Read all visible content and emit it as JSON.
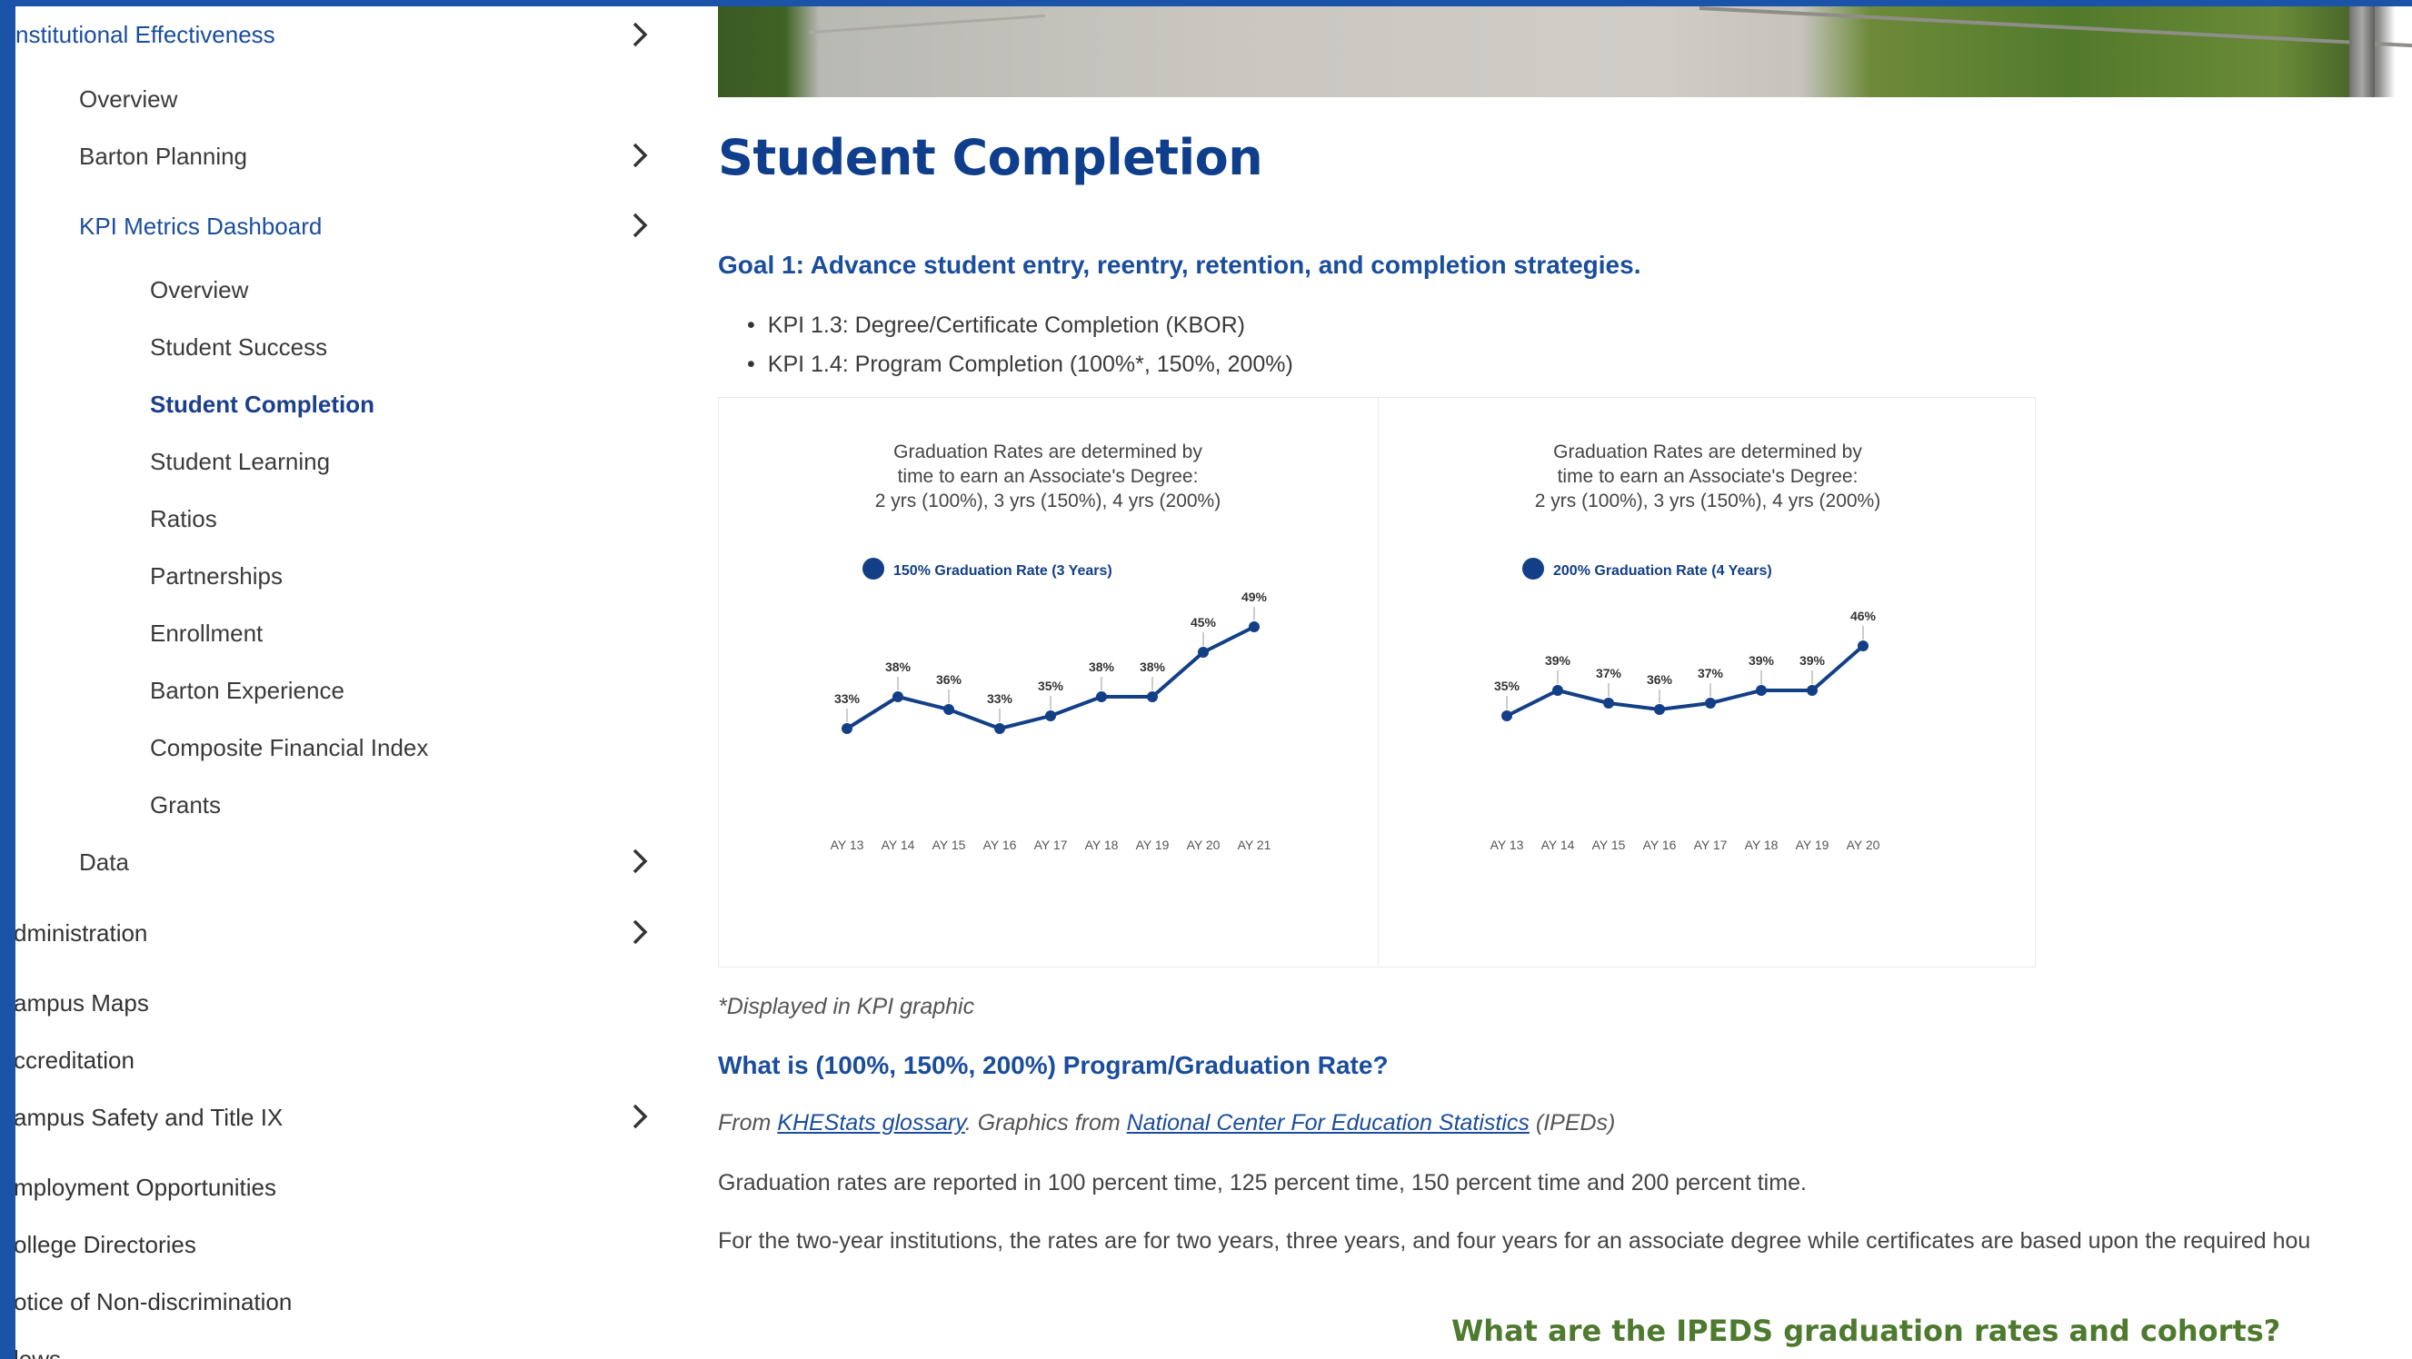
{
  "sidebar": {
    "section_title": "nstitutional Effectiveness",
    "items": [
      {
        "label": "Overview"
      },
      {
        "label": "Barton Planning"
      },
      {
        "label": "KPI Metrics Dashboard"
      },
      {
        "label": "Overview"
      },
      {
        "label": "Student Success"
      },
      {
        "label": "Student Completion"
      },
      {
        "label": "Student Learning"
      },
      {
        "label": "Ratios"
      },
      {
        "label": "Partnerships"
      },
      {
        "label": "Enrollment"
      },
      {
        "label": "Barton Experience"
      },
      {
        "label": "Composite Financial Index"
      },
      {
        "label": "Grants"
      },
      {
        "label": "Data"
      },
      {
        "label": "dministration"
      },
      {
        "label": "ampus Maps"
      },
      {
        "label": "ccreditation"
      },
      {
        "label": "ampus Safety and Title IX"
      },
      {
        "label": "mployment Opportunities"
      },
      {
        "label": "ollege Directories"
      },
      {
        "label": "otice of Non-discrimination"
      },
      {
        "label": "lews"
      }
    ]
  },
  "main": {
    "title": "Student Completion",
    "goal": "Goal 1: Advance student entry, reentry, retention, and completion strategies.",
    "bullets": [
      "KPI 1.3: Degree/Certificate Completion (KBOR)",
      "KPI 1.4: Program Completion (100%*, 150%, 200%)"
    ],
    "footnote": "*Displayed in KPI graphic",
    "question": "What is (100%, 150%, 200%) Program/Graduation Rate?",
    "source": {
      "prefix": "From ",
      "link1": "KHEStats glossary",
      "middle": ". Graphics from ",
      "link2": "National Center For Education Statistics",
      "suffix": " (IPEDs)"
    },
    "paragraph1": "Graduation rates are reported in 100 percent time, 125 percent time, 150 percent time and 200 percent time.",
    "paragraph2": "For the two-year institutions, the rates are for two years, three years, and four years for an associate degree while certificates are based upon the required hou",
    "ipeds_heading": "What are the IPEDS graduation rates and cohorts?"
  },
  "colors": {
    "frame": "#1a53a8",
    "heading": "#0f3e8c",
    "link": "#1a4d9c",
    "series": "#123f86",
    "ipeds_heading": "#4d7a2e"
  },
  "chart_data": [
    {
      "type": "line",
      "title_lines": [
        "Graduation Rates are determined by",
        "time to earn an Associate's Degree:",
        "2 yrs (100%), 3 yrs (150%), 4 yrs (200%)"
      ],
      "legend": "top-left",
      "grid": false,
      "categories": [
        "AY 13",
        "AY 14",
        "AY 15",
        "AY 16",
        "AY 17",
        "AY 18",
        "AY 19",
        "AY 20",
        "AY 21"
      ],
      "series": [
        {
          "name": "150% Graduation Rate (3 Years)",
          "values": [
            33,
            38,
            36,
            33,
            35,
            38,
            38,
            45,
            49
          ],
          "labels": [
            "33%",
            "38%",
            "36%",
            "33%",
            "35%",
            "38%",
            "38%",
            "45%",
            "49%"
          ]
        }
      ],
      "ylim": [
        25,
        55
      ]
    },
    {
      "type": "line",
      "title_lines": [
        "Graduation Rates are determined by",
        "time to earn an Associate's Degree:",
        "2 yrs (100%), 3 yrs (150%), 4 yrs (200%)"
      ],
      "legend": "top-left",
      "grid": false,
      "categories": [
        "AY 13",
        "AY 14",
        "AY 15",
        "AY 16",
        "AY 17",
        "AY 18",
        "AY 19",
        "AY 20"
      ],
      "series": [
        {
          "name": "200% Graduation Rate (4 Years)",
          "values": [
            35,
            39,
            37,
            36,
            37,
            39,
            39,
            46
          ],
          "labels": [
            "35%",
            "39%",
            "37%",
            "36%",
            "37%",
            "39%",
            "39%",
            "46%"
          ]
        }
      ],
      "ylim": [
        25,
        55
      ]
    }
  ]
}
